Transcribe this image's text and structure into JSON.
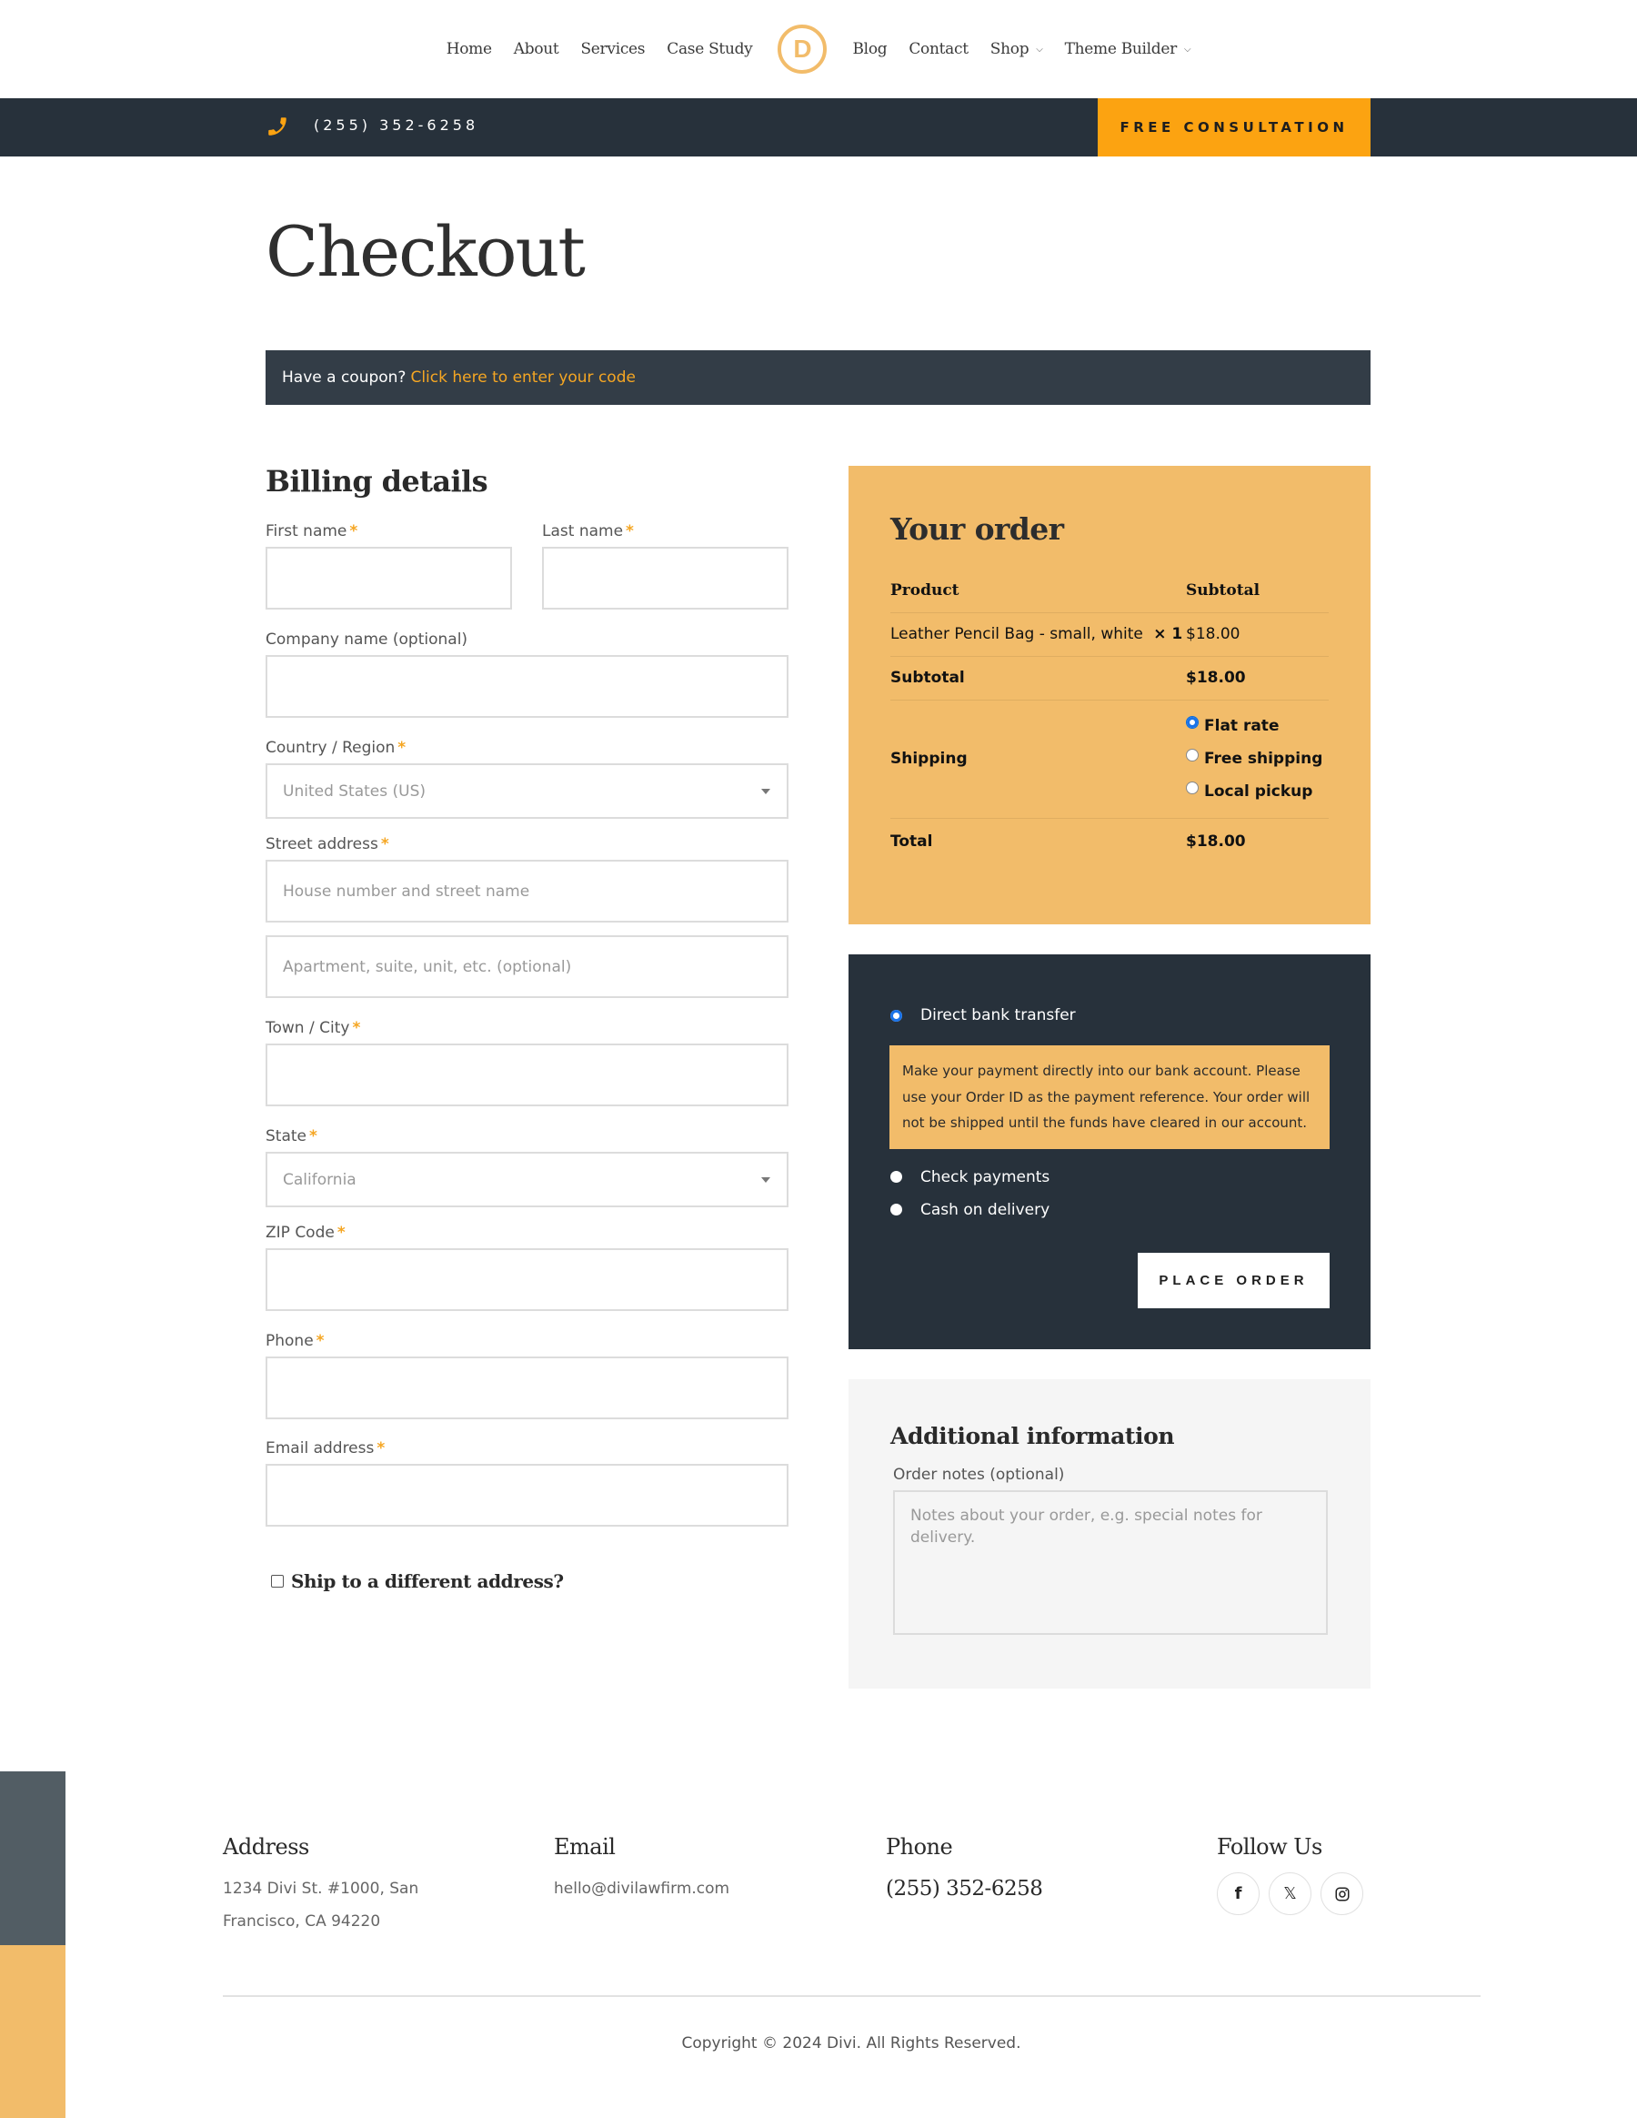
{
  "nav": {
    "items_left": [
      {
        "label": "Home"
      },
      {
        "label": "About"
      },
      {
        "label": "Services"
      },
      {
        "label": "Case Study"
      }
    ],
    "logo_letter": "D",
    "items_right": [
      {
        "label": "Blog"
      },
      {
        "label": "Contact"
      },
      {
        "label": "Shop",
        "has_dropdown": true
      },
      {
        "label": "Theme Builder",
        "has_dropdown": true
      }
    ],
    "chevron_glyph": "⌄"
  },
  "topbar": {
    "phone": "(255) 352-6258",
    "cta_label": "FREE CONSULTATION"
  },
  "page_title": "Checkout",
  "coupon": {
    "prompt": "Have a coupon?",
    "link": "Click here to enter your code"
  },
  "billing": {
    "heading": "Billing details",
    "required_mark": "*",
    "first_name_label": "First name",
    "last_name_label": "Last name",
    "company_label": "Company name (optional)",
    "country_label": "Country / Region",
    "country_value": "United States (US)",
    "street_label": "Street address",
    "street_placeholder_1": "House number and street name",
    "street_placeholder_2": "Apartment, suite, unit, etc. (optional)",
    "city_label": "Town / City",
    "state_label": "State",
    "state_value": "California",
    "zip_label": "ZIP Code",
    "phone_label": "Phone",
    "email_label": "Email address",
    "ship_different_label": "Ship to a different address?"
  },
  "order": {
    "heading": "Your order",
    "col_product": "Product",
    "col_subtotal": "Subtotal",
    "items": [
      {
        "name": "Leather Pencil Bag - small, white",
        "qty": "× 1",
        "subtotal": "$18.00"
      }
    ],
    "subtotal_label": "Subtotal",
    "subtotal_value": "$18.00",
    "shipping_label": "Shipping",
    "shipping_options": [
      {
        "label": "Flat rate",
        "selected": true
      },
      {
        "label": "Free shipping",
        "selected": false
      },
      {
        "label": "Local pickup",
        "selected": false
      }
    ],
    "total_label": "Total",
    "total_value": "$18.00"
  },
  "payment": {
    "methods": [
      {
        "label": "Direct bank transfer",
        "selected": true
      },
      {
        "label": "Check payments",
        "selected": false
      },
      {
        "label": "Cash on delivery",
        "selected": false
      }
    ],
    "description": "Make your payment directly into our bank account. Please use your Order ID as the payment reference. Your order will not be shipped until the funds have cleared in our account.",
    "place_order_label": "PLACE ORDER"
  },
  "additional": {
    "heading": "Additional information",
    "notes_label": "Order notes (optional)",
    "notes_placeholder": "Notes about your order, e.g. special notes for delivery."
  },
  "footer": {
    "address_heading": "Address",
    "address_line1": "1234 Divi St. #1000, San",
    "address_line2": "Francisco, CA 94220",
    "email_heading": "Email",
    "email": "hello@divilawfirm.com",
    "phone_heading": "Phone",
    "phone": "(255) 352-6258",
    "follow_heading": "Follow Us",
    "socials": [
      {
        "name": "facebook",
        "glyph": "f"
      },
      {
        "name": "x",
        "glyph": "𝕏"
      },
      {
        "name": "instagram",
        "glyph": "◎"
      }
    ],
    "copyright": "Copyright © 2024 Divi. All Rights Reserved."
  },
  "colors": {
    "accent_orange": "#fca311",
    "gold": "#f2bc6a",
    "dark": "#27313b",
    "coupon_bg": "#333d47",
    "side_slate": "#525d64"
  }
}
